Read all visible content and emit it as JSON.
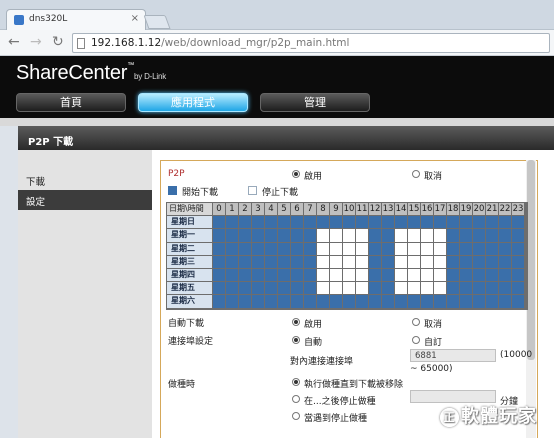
{
  "browser": {
    "tab_title": "dns320L",
    "url_host": "192.168.1.12",
    "url_path": "/web/download_mgr/p2p_main.html"
  },
  "header": {
    "brand": "ShareCenter",
    "brand_tm": "™",
    "brand_by": "by D-Link"
  },
  "menu": [
    {
      "label": "首頁"
    },
    {
      "label": "應用程式"
    },
    {
      "label": "管理"
    }
  ],
  "section": {
    "title": "P2P 下載"
  },
  "sidebar": {
    "items": [
      {
        "label": "下載"
      },
      {
        "label": "設定"
      }
    ]
  },
  "form": {
    "p2p_label": "P2P",
    "enable": "啟用",
    "disable": "取消",
    "legend_start": "開始下載",
    "legend_stop": "停止下載",
    "grid_corner": "日期\\時間",
    "hours": [
      "0",
      "1",
      "2",
      "3",
      "4",
      "5",
      "6",
      "7",
      "8",
      "9",
      "10",
      "11",
      "12",
      "13",
      "14",
      "15",
      "16",
      "17",
      "18",
      "19",
      "20",
      "21",
      "22",
      "23"
    ],
    "days": [
      "星期日",
      "星期一",
      "星期二",
      "星期三",
      "星期四",
      "星期五",
      "星期六"
    ],
    "auto_dl_label": "自動下載",
    "auto_enable": "啟用",
    "auto_disable": "取消",
    "port_label": "連接埠設定",
    "port_auto": "自動",
    "port_custom": "自訂",
    "port_field_label": "對內連接連接埠",
    "port_value": "6881",
    "port_range_a": "(10000",
    "port_range_b": "~ 65000)",
    "seed_label": "做種時",
    "seed_opt1": "執行做種直到下載被移除",
    "seed_opt2": "在...之後停止做種",
    "seed_opt3": "當遇到停止做種",
    "minutes": "分鐘"
  },
  "colors": {
    "start": "#3a6faa",
    "stop": "#ffffff",
    "accent": "#1fa6e6"
  },
  "watermark": {
    "circle": "正",
    "text": "軟體玩家"
  }
}
